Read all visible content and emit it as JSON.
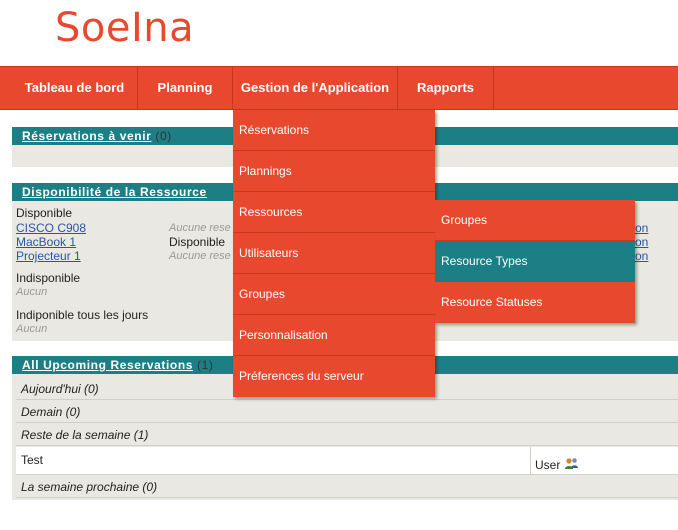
{
  "logo": {
    "text": "SoeIna"
  },
  "nav": {
    "items": [
      "Tableau de bord",
      "Planning",
      "Gestion de l'Application",
      "Rapports"
    ]
  },
  "reservations_panel": {
    "title": "Réservations à venir",
    "count": "(0)"
  },
  "availability_panel": {
    "title": "Disponibilité de la Ressource",
    "available_label": "Disponible",
    "resources": [
      "CISCO C908",
      "MacBook 1",
      "Projecteur 1"
    ],
    "col_notes": [
      "Aucune rese",
      "Disponible",
      "Aucune rese"
    ],
    "unavailable_label": "Indisponible",
    "unavailable_value": "Aucun",
    "all_day_label": "Indiponible tous les jours",
    "all_day_value": "Aucun",
    "right_links": [
      "on",
      "on",
      "on"
    ]
  },
  "upcoming_panel": {
    "title": "All Upcoming Reservations",
    "count": "(1)",
    "rows": [
      "Aujourd'hui (0)",
      "Demain (0)",
      "Reste de la semaine (1)",
      "La semaine prochaine (0)"
    ],
    "test_row": {
      "title": "Test",
      "user": "User"
    }
  },
  "dropdown": {
    "items": [
      "Réservations",
      "Plannings",
      "Ressources",
      "Utilisateurs",
      "Groupes",
      "Personnalisation",
      "Préferences du serveur"
    ]
  },
  "submenu": {
    "items": [
      "Groupes",
      "Resource Types",
      "Resource Statuses"
    ]
  },
  "colors": {
    "accent": "#e8492e",
    "teal": "#1d7f86"
  }
}
